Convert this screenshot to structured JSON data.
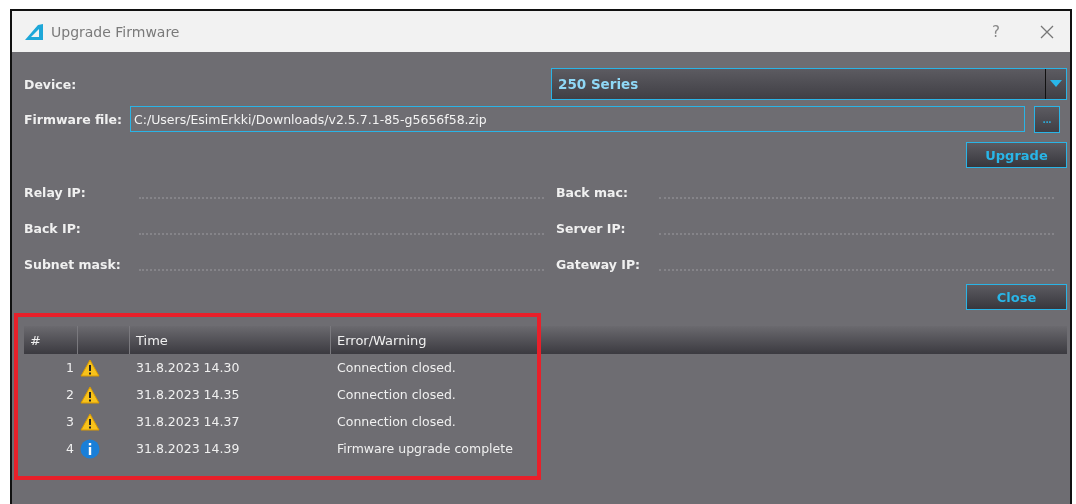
{
  "window": {
    "title": "Upgrade Firmware",
    "help": "?"
  },
  "device": {
    "label": "Device:",
    "value": "250 Series"
  },
  "firmware_file": {
    "label": "Firmware file:",
    "value": "C:/Users/EsimErkki/Downloads/v2.5.7.1-85-g5656f58.zip",
    "browse": "..."
  },
  "upgrade_button": "Upgrade",
  "fields": [
    {
      "label": "Relay IP:"
    },
    {
      "label": "Back mac:"
    },
    {
      "label": "Back IP:"
    },
    {
      "label": "Server IP:"
    },
    {
      "label": "Subnet mask:"
    },
    {
      "label": "Gateway IP:"
    }
  ],
  "close_button": "Close",
  "log": {
    "columns": [
      "#",
      "Time",
      "Error/Warning"
    ],
    "rows": [
      {
        "index": "1",
        "kind": "warning",
        "time": "31.8.2023 14.30",
        "message": "Connection closed."
      },
      {
        "index": "2",
        "kind": "warning",
        "time": "31.8.2023 14.35",
        "message": "Connection closed."
      },
      {
        "index": "3",
        "kind": "warning",
        "time": "31.8.2023 14.37",
        "message": "Connection closed."
      },
      {
        "index": "4",
        "kind": "info",
        "time": "31.8.2023 14.39",
        "message": "Firmware upgrade complete"
      }
    ]
  }
}
